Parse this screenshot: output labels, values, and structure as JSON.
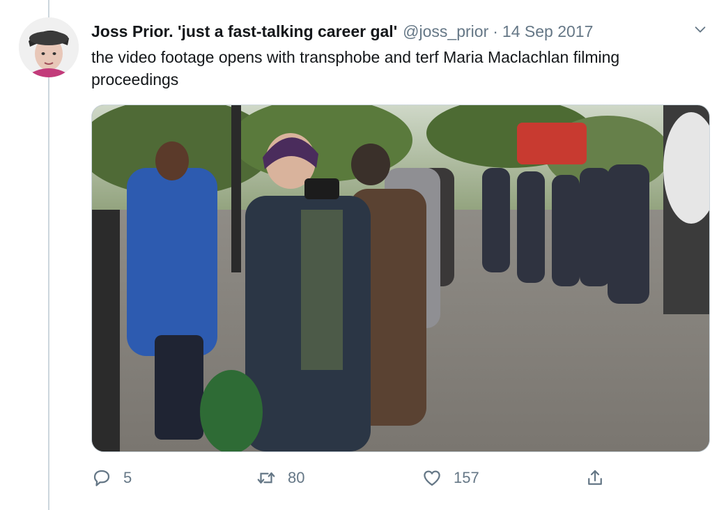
{
  "tweet": {
    "display_name": "Joss Prior. 'just a fast-talking career gal'",
    "handle": "@joss_prior",
    "separator": "·",
    "timestamp": "14 Sep 2017",
    "text": "the video footage opens with transphobe and terf Maria Maclachlan filming proceedings",
    "avatar_icon": "profile-avatar",
    "menu_icon": "chevron-down-icon",
    "media_description_icon": "photo-media"
  },
  "actions": {
    "reply": {
      "icon": "reply-icon",
      "count": "5"
    },
    "retweet": {
      "icon": "retweet-icon",
      "count": "80"
    },
    "like": {
      "icon": "heart-icon",
      "count": "157"
    },
    "share": {
      "icon": "share-icon"
    }
  },
  "colors": {
    "text_primary": "#14171a",
    "text_secondary": "#657786",
    "border": "#ccd6dd",
    "background": "#ffffff"
  }
}
